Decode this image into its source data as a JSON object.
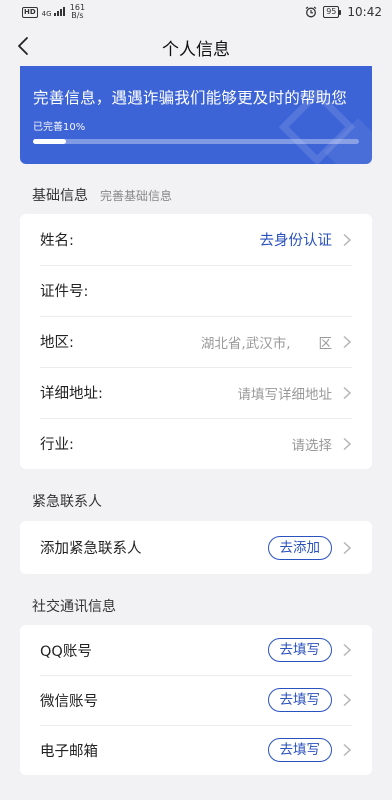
{
  "status_bar": {
    "hd": "HD",
    "network": "4G",
    "speed_value": "161",
    "speed_unit": "B/s",
    "battery": "95",
    "time": "10:42"
  },
  "nav": {
    "title": "个人信息"
  },
  "banner": {
    "headline": "完善信息，遇遇诈骗我们能够更及时的帮助您",
    "progress_text": "已完善10%",
    "progress_fraction": 0.1
  },
  "basic": {
    "title": "基础信息",
    "subtitle": "完善基础信息",
    "rows": [
      {
        "label": "姓名:",
        "value": "去身份认证"
      },
      {
        "label": "证件号:",
        "value": ""
      },
      {
        "label": "地区:",
        "value_a": "湖北省,武汉市,",
        "value_b": "区"
      },
      {
        "label": "详细地址:",
        "value": "请填写详细地址"
      },
      {
        "label": "行业:",
        "value": "请选择"
      }
    ]
  },
  "emergency": {
    "title": "紧急联系人",
    "row": {
      "label": "添加紧急联系人",
      "button": "去添加"
    }
  },
  "social": {
    "title": "社交通讯信息",
    "rows": [
      {
        "label": "QQ账号",
        "button": "去填写"
      },
      {
        "label": "微信账号",
        "button": "去填写"
      },
      {
        "label": "电子邮箱",
        "button": "去填写"
      }
    ]
  },
  "colors": {
    "accent": "#2a52be",
    "banner": "#3d64d6",
    "background": "#f2f2f4"
  }
}
